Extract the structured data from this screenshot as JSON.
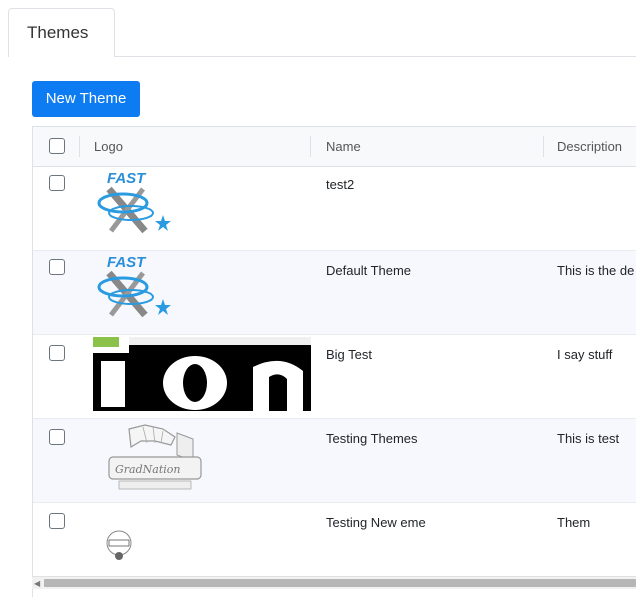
{
  "tabs": [
    {
      "label": "Themes"
    }
  ],
  "toolbar": {
    "new_label": "New Theme"
  },
  "table": {
    "columns": {
      "logo": "Logo",
      "name": "Name",
      "description": "Description"
    },
    "rows": [
      {
        "name": "test2",
        "description": "",
        "logo": "fast-logo"
      },
      {
        "name": "Default Theme",
        "description": "This is the de",
        "logo": "fast-logo"
      },
      {
        "name": "Big Test",
        "description": "I say stuff",
        "logo": "ion-logo"
      },
      {
        "name": "Testing Themes",
        "description": "This is test",
        "logo": "gradnation-logo"
      },
      {
        "name": "Testing New eme",
        "description": "Them",
        "logo": "camino-logo"
      }
    ]
  },
  "colors": {
    "accent": "#0d7cf2",
    "header_bg": "#f8f9fa",
    "alt_row_bg": "#f6f8fe"
  }
}
